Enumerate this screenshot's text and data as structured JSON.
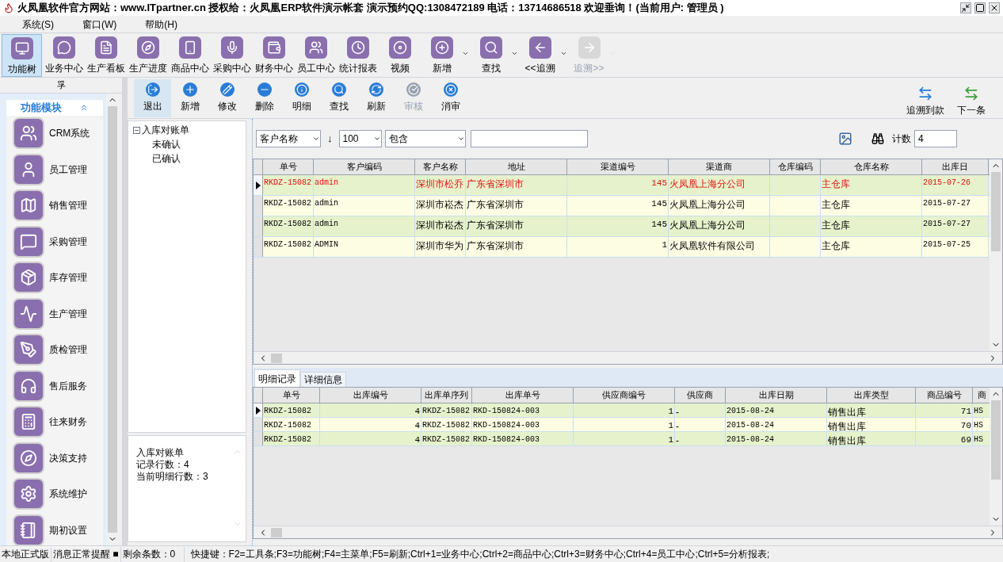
{
  "window": {
    "title": "火凤凰软件官方网站：www.ITpartner.cn   授权给：火凤凰ERP软件演示帐套 演示预约QQ:1308472189  电话：13714686518  欢迎垂询！(当前用户: 管理员 )"
  },
  "menu": [
    {
      "label": "系统(S)"
    },
    {
      "label": "窗口(W)"
    },
    {
      "label": "帮助(H)"
    }
  ],
  "toolbar": [
    {
      "label": "功能树",
      "selected": true,
      "dropdown": false,
      "disabled": false
    },
    {
      "label": "业务中心",
      "selected": false,
      "dropdown": false,
      "disabled": false
    },
    {
      "label": "生产看板",
      "selected": false,
      "dropdown": false,
      "disabled": false
    },
    {
      "label": "生产进度",
      "selected": false,
      "dropdown": false,
      "disabled": false
    },
    {
      "label": "商品中心",
      "selected": false,
      "dropdown": false,
      "disabled": false
    },
    {
      "label": "采购中心",
      "selected": false,
      "dropdown": false,
      "disabled": false
    },
    {
      "label": "财务中心",
      "selected": false,
      "dropdown": false,
      "disabled": false
    },
    {
      "label": "员工中心",
      "selected": false,
      "dropdown": false,
      "disabled": false
    },
    {
      "label": "统计报表",
      "selected": false,
      "dropdown": false,
      "disabled": false
    },
    {
      "label": "视频",
      "selected": false,
      "dropdown": false,
      "disabled": false
    },
    {
      "label": "新增",
      "selected": false,
      "dropdown": true,
      "disabled": false
    },
    {
      "label": "查找",
      "selected": false,
      "dropdown": true,
      "disabled": false
    },
    {
      "label": "<<追溯",
      "selected": false,
      "dropdown": true,
      "disabled": false
    },
    {
      "label": "追溯>>",
      "selected": false,
      "dropdown": true,
      "disabled": true
    }
  ],
  "sidebar": {
    "header": "孚",
    "title": "功能模块",
    "items": [
      {
        "label": "CRM系统"
      },
      {
        "label": "员工管理"
      },
      {
        "label": "销售管理"
      },
      {
        "label": "采购管理"
      },
      {
        "label": "库存管理"
      },
      {
        "label": "生产管理"
      },
      {
        "label": "质检管理"
      },
      {
        "label": "售后服务"
      },
      {
        "label": "往来财务"
      },
      {
        "label": "决策支持"
      },
      {
        "label": "系统维护"
      },
      {
        "label": "期初设置"
      }
    ]
  },
  "actions": [
    {
      "label": "退出",
      "hovered": true,
      "disabled": false
    },
    {
      "label": "新增",
      "hovered": false,
      "disabled": false
    },
    {
      "label": "修改",
      "hovered": false,
      "disabled": false
    },
    {
      "label": "删除",
      "hovered": false,
      "disabled": false
    },
    {
      "label": "明细",
      "hovered": false,
      "disabled": false
    },
    {
      "label": "查找",
      "hovered": false,
      "disabled": false
    },
    {
      "label": "刷新",
      "hovered": false,
      "disabled": false
    },
    {
      "label": "审核",
      "hovered": false,
      "disabled": true
    },
    {
      "label": "消审",
      "hovered": false,
      "disabled": false
    }
  ],
  "nav_actions": [
    {
      "label": "追溯到款"
    },
    {
      "label": "下一条"
    }
  ],
  "tree": {
    "label": "入库对账单",
    "expanded": true,
    "children": [
      {
        "label": "未确认"
      },
      {
        "label": "已确认"
      }
    ]
  },
  "info_lines": [
    "入库对账单",
    "记录行数：4",
    "当前明细行数：3"
  ],
  "filter": {
    "field": "客户名称",
    "sort": "↓",
    "limit": "100",
    "operator": "包含",
    "count_label": "计数",
    "count": "4"
  },
  "main_table": {
    "columns": [
      {
        "label": "单号",
        "kind": "code"
      },
      {
        "label": "客户编码",
        "kind": "code"
      },
      {
        "label": "客户名称",
        "kind": "text"
      },
      {
        "label": "地址",
        "kind": "text"
      },
      {
        "label": "渠道编号",
        "kind": "number"
      },
      {
        "label": "渠道商",
        "kind": "text"
      },
      {
        "label": "仓库编码",
        "kind": "text"
      },
      {
        "label": "仓库名称",
        "kind": "text"
      },
      {
        "label": "出库日",
        "kind": "code"
      }
    ],
    "rows": [
      {
        "selected": true,
        "cells": [
          "RKDZ-15082",
          "admin",
          "深圳市松乔",
          "广东省深圳市",
          "145",
          "火凤凰上海分公司",
          "",
          "主仓库",
          "2015-07-26"
        ]
      },
      {
        "selected": false,
        "cells": [
          "RKDZ-15082",
          "admin",
          "深圳市崧杰",
          "广东省深圳市",
          "145",
          "火凤凰上海分公司",
          "",
          "主仓库",
          "2015-07-27"
        ]
      },
      {
        "selected": false,
        "cells": [
          "RKDZ-15082",
          "admin",
          "深圳市崧杰",
          "广东省深圳市",
          "145",
          "火凤凰上海分公司",
          "",
          "主仓库",
          "2015-07-27"
        ]
      },
      {
        "selected": false,
        "cells": [
          "RKDZ-15082",
          "ADMIN",
          "深圳市华为",
          "广东省深圳市",
          "1",
          "火凤凰软件有限公司",
          "",
          "主仓库",
          "2015-07-25"
        ]
      }
    ]
  },
  "detail_tabs": [
    {
      "label": "明细记录",
      "selected": true
    },
    {
      "label": "详细信息",
      "selected": false
    }
  ],
  "detail_table": {
    "columns": [
      {
        "label": "单号",
        "kind": "code"
      },
      {
        "label": "出库编号",
        "kind": "number"
      },
      {
        "label": "出库单序列",
        "kind": "code"
      },
      {
        "label": "出库单号",
        "kind": "code"
      },
      {
        "label": "供应商编号",
        "kind": "number"
      },
      {
        "label": "供应商",
        "kind": "text"
      },
      {
        "label": "出库日期",
        "kind": "code"
      },
      {
        "label": "出库类型",
        "kind": "text"
      },
      {
        "label": "商品编号",
        "kind": "number"
      },
      {
        "label": "商",
        "kind": "code"
      }
    ],
    "rows": [
      {
        "selected": true,
        "cells": [
          "RKDZ-15082",
          "4",
          "RKDZ-15082",
          "RKD-150824-003",
          "1",
          "-",
          "2015-08-24",
          "销售出库",
          "71",
          "HS"
        ]
      },
      {
        "selected": false,
        "cells": [
          "RKDZ-15082",
          "4",
          "RKDZ-15082",
          "RKD-150824-003",
          "1",
          "-",
          "2015-08-24",
          "销售出库",
          "70",
          "HS"
        ]
      },
      {
        "selected": false,
        "cells": [
          "RKDZ-15082",
          "4",
          "RKDZ-15082",
          "RKD-150824-003",
          "1",
          "-",
          "2015-08-24",
          "销售出库",
          "69",
          "HS"
        ]
      }
    ]
  },
  "status_bar": [
    "本地正式版",
    "消息正常提醒 ■",
    "剩余条数：0",
    "快捷键：F2=工具条;F3=功能树;F4=主菜单;F5=刷新;Ctrl+1=业务中心;Ctrl+2=商品中心;Ctrl+3=财务中心;Ctrl+4=员工中心;Ctrl+5=分析报表;"
  ]
}
